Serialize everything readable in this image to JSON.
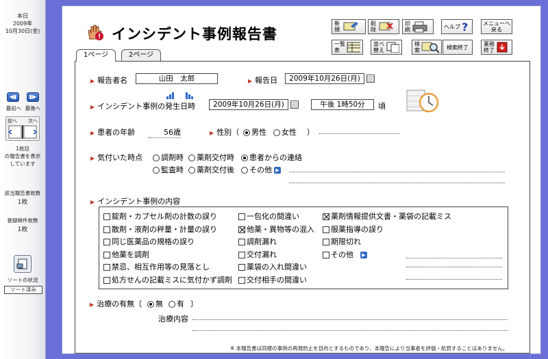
{
  "sidebar": {
    "today_label": "本日",
    "today_year": "2009年",
    "today_date": "10月30日(金)",
    "first_label": "最初へ",
    "last_label": "最後へ",
    "prev_label": "前へ",
    "next_label": "次へ",
    "page_info": [
      "1枚目",
      "の報告書を表示",
      "しています"
    ],
    "count_label": "該当報告書枚数",
    "count_value": "1枚",
    "registered_label": "登録締件枚数",
    "registered_value": "1枚",
    "sort_label": "ソートの状況",
    "sort_status": "ソート済み"
  },
  "header": {
    "title": "インシデント事例報告書",
    "buttons": {
      "new": "新\n規",
      "delete": "削\n除",
      "print": "印\n刷",
      "help": "ヘルプ",
      "menu": "メニューへ\n戻る",
      "list": "一覧\n表",
      "sort": "並べ\n替え",
      "search": "検\n索",
      "search_end": "検索終了",
      "finish": "業務\n終了"
    }
  },
  "tabs": [
    "1ページ",
    "2ページ"
  ],
  "form": {
    "reporter_label": "報告者名",
    "reporter_value": "山田　太郎",
    "report_date_label": "報告日",
    "report_date_value": "2009年10月26日(月)",
    "occurrence_label": "インシデント事例の発生日時",
    "occurrence_date": "2009年10月26日(月)",
    "occurrence_time": "午後 1時50分",
    "occurrence_suffix": "頃",
    "age_label": "患者の年齢",
    "age_value": "56歳",
    "sex_label": "性別（",
    "sex_close": "）",
    "sex_options": [
      "男性",
      "女性"
    ],
    "sex_selected": 0,
    "noticed_label": "気付いた時点",
    "noticed_options": [
      "調剤時",
      "薬剤交付時",
      "患者からの連絡",
      "監査時",
      "薬剤交付後",
      "その他"
    ],
    "noticed_selected": 2,
    "incident_label": "インシデント事例の内容",
    "incident_items": [
      {
        "label": "錠剤・カプセル剤の計数の誤り",
        "checked": false
      },
      {
        "label": "散剤・液剤の秤量・計量の誤り",
        "checked": false
      },
      {
        "label": "同じ医薬品の規格の誤り",
        "checked": false
      },
      {
        "label": "他薬を調剤",
        "checked": false
      },
      {
        "label": "禁忌、相互作用等の見落とし",
        "checked": false
      },
      {
        "label": "処方せんの記載ミスに気付かず調剤",
        "checked": false
      },
      {
        "label": "一包化の間違い",
        "checked": false
      },
      {
        "label": "他薬・異物等の混入",
        "checked": true
      },
      {
        "label": "調剤漏れ",
        "checked": false
      },
      {
        "label": "交付漏れ",
        "checked": false
      },
      {
        "label": "薬袋の入れ間違い",
        "checked": false
      },
      {
        "label": "交付相手の間違い",
        "checked": false
      },
      {
        "label": "薬剤情報提供文書・薬袋の記載ミス",
        "checked": true
      },
      {
        "label": "服薬指導の誤り",
        "checked": false
      },
      {
        "label": "期限切れ",
        "checked": false
      },
      {
        "label": "その他",
        "checked": false
      }
    ],
    "treatment_label": "治療の有無〔",
    "treatment_close": "〕",
    "treatment_options": [
      "無",
      "有"
    ],
    "treatment_selected": 0,
    "treatment_detail_label": "治療内容",
    "footer_note": "※ 本報告書は同様の事例の再発防止を目的とするものであり、本報告により当事者を評価・処罰することはありません。"
  },
  "colors": {
    "background": "#6a6fd8",
    "label_arrow": "#c0392b",
    "accent_blue": "#2a6ad0"
  }
}
